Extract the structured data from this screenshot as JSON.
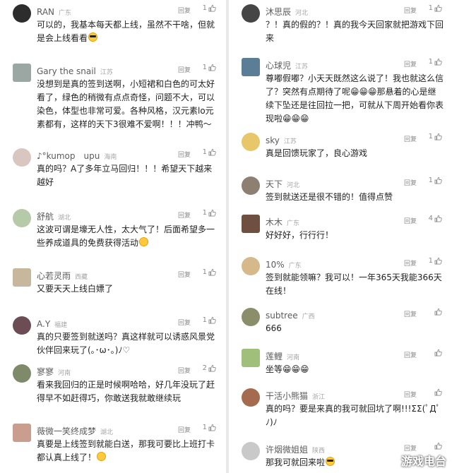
{
  "colors": {
    "text": "#1f1f1f",
    "name": "#5b5b5b",
    "meta": "#a6a6a6"
  },
  "left_comments": [
    {
      "name": "RAN",
      "location": "广东",
      "reply": "回复",
      "likes": "1",
      "text": "可以的，我基本每天都上线，虽然不干啥，但就是会上线看看",
      "emoji": "cool",
      "avatar_color": "#2d2d2d"
    },
    {
      "name": "Gary the snail",
      "location": "江苏",
      "reply": "回复",
      "likes": "1",
      "text": "没想到是真的签到送啊，小短裙和白色的可太好看了，绿色的稍微有点点奇怪，问题不大，可以染色，体型也非常可爱。各种风格，汉元素lo元素都有，这样的天下3很难不爱啊！！！冲鸭～",
      "emoji": "",
      "avatar_color": "#9aa7a2"
    },
    {
      "name": "♪°kumop　upu",
      "location": "海南",
      "reply": "回复",
      "likes": "1",
      "text": "真的吗？A了多年立马回归！！！希望天下越来越好",
      "emoji": "",
      "avatar_color": "#d9c6c0"
    },
    {
      "name": "舒航",
      "location": "湖北",
      "reply": "回复",
      "likes": "1",
      "text": "这波可谓是壕无人性，太大气了！后面希望多一些养成道具的免费获得活动",
      "emoji": "grin",
      "avatar_color": "#b6c9a8"
    },
    {
      "name": "心若灵雨",
      "location": "西藏",
      "reply": "回复",
      "likes": "1",
      "text": "又要天天上线白嫖了",
      "emoji": "",
      "avatar_color": "#c7b89d"
    },
    {
      "name": "A.Y",
      "location": "福建",
      "reply": "回复",
      "likes": "1",
      "text": "真的只要签到就送吗？真这样就可以诱惑风景党伙伴回来玩了(｡･ω･｡)ﾉ♡",
      "emoji": "",
      "avatar_color": "#6c4d55"
    },
    {
      "name": "寥寥",
      "location": "河南",
      "reply": "回复",
      "likes": "2",
      "text": "看来我回归的正是时候啊哈哈，好几年没玩了赶得早不如赶得巧，你敢送我就敢继续玩",
      "emoji": "",
      "avatar_color": "#7f8a6a"
    },
    {
      "name": "薇微一笑终成梦",
      "location": "湖北",
      "reply": "回复",
      "likes": "1",
      "text": "真要是上线签到就能白送，那我可要比上班打卡都认真上线了！",
      "emoji": "grin",
      "avatar_color": "#c99e8f"
    }
  ],
  "right_comments": [
    {
      "name": "沐思辰",
      "location": "河北",
      "reply": "回复",
      "likes": "1",
      "text": "？！真的假的？！真的我今天回家就把游戏下回来",
      "emoji": "",
      "avatar_color": "#454545"
    },
    {
      "name": "心球児",
      "location": "江苏",
      "reply": "回复",
      "likes": "1",
      "text": "尊嘟假嘟？小天天既然这么说了！我也就这么信了？突然有点期待了呢😁😁😁那悬着的心是继续下坠还是往回拉一把，可就从下周开始看你表现啦😁😁😁",
      "emoji": "",
      "avatar_color": "#5b7d95"
    },
    {
      "name": "sky",
      "location": "江苏",
      "reply": "回复",
      "likes": "1",
      "text": "真是回馈玩家了，良心游戏",
      "emoji": "",
      "avatar_color": "#e8c76a"
    },
    {
      "name": "天下",
      "location": "河北",
      "reply": "回复",
      "likes": "1",
      "text": "签到就送还是很不错的！值得点赞",
      "emoji": "",
      "avatar_color": "#8d7f71"
    },
    {
      "name": "木木",
      "location": "广东",
      "reply": "回复",
      "likes": "4",
      "text": "好好好，行行行！",
      "emoji": "",
      "avatar_color": "#6f4f3f"
    },
    {
      "name": "10%",
      "location": "广东",
      "reply": "回复",
      "likes": "1",
      "text": "签到就能领嘛？我可以！一年365天我能366天在线！",
      "emoji": "",
      "avatar_color": "#d6b98a"
    },
    {
      "name": "subtree",
      "location": "广西",
      "reply": "回复",
      "likes": "",
      "text": "666",
      "emoji": "",
      "avatar_color": "#8a8e6a"
    },
    {
      "name": "莲鲤",
      "location": "河南",
      "reply": "回复",
      "likes": "",
      "text": "坐等😁😁😁",
      "emoji": "",
      "avatar_color": "#9fbf7a"
    },
    {
      "name": "干活小熊猫",
      "location": "浙江",
      "reply": "回复",
      "likes": "",
      "text": "真的吗？要是来真的我可就回坑了啊!!!ΣΣ(ﾟДﾟﾉ)ﾉ",
      "emoji": "",
      "avatar_color": "#a56b4e"
    },
    {
      "name": "许烟微姐姐",
      "location": "陕西",
      "reply": "回复",
      "likes": "",
      "text": "那我可就回来啦",
      "emoji": "cool",
      "avatar_color": "#c9c9c9"
    }
  ],
  "watermark": "游戏电台"
}
